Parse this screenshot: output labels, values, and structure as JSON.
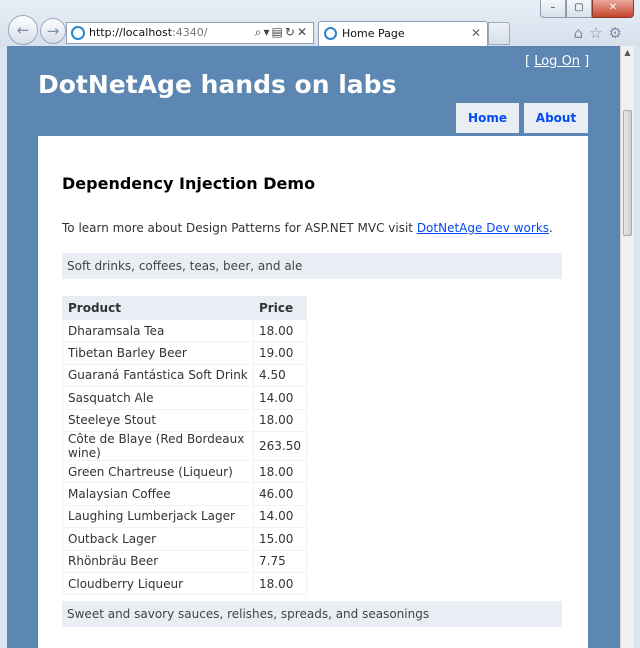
{
  "browser": {
    "url_host": "http://localhost",
    "url_port": ":4340/",
    "tab_title": "Home Page"
  },
  "site": {
    "title": "DotNetAge hands on labs",
    "logon_open": "[ ",
    "logon_label": "Log On",
    "logon_close": " ]",
    "menu": [
      "Home",
      "About"
    ]
  },
  "content": {
    "heading": "Dependency Injection Demo",
    "intro_text": "To learn more about Design Patterns for ASP.NET MVC visit ",
    "intro_link": "DotNetAge Dev works",
    "intro_end": ".",
    "categories": [
      "Soft drinks, coffees, teas, beer, and ale",
      "Sweet and savory sauces, relishes, spreads, and seasonings"
    ],
    "table": {
      "headers": [
        "Product",
        "Price"
      ],
      "rows": [
        [
          "Dharamsala Tea",
          "18.00"
        ],
        [
          "Tibetan Barley Beer",
          "19.00"
        ],
        [
          "Guaraná Fantástica Soft Drink",
          "4.50"
        ],
        [
          "Sasquatch Ale",
          "14.00"
        ],
        [
          "Steeleye Stout",
          "18.00"
        ],
        [
          "Côte de Blaye (Red Bordeaux wine)",
          "263.50"
        ],
        [
          "Green Chartreuse (Liqueur)",
          "18.00"
        ],
        [
          "Malaysian Coffee",
          "46.00"
        ],
        [
          "Laughing Lumberjack Lager",
          "14.00"
        ],
        [
          "Outback Lager",
          "15.00"
        ],
        [
          "Rhönbräu Beer",
          "7.75"
        ],
        [
          "Cloudberry Liqueur",
          "18.00"
        ]
      ]
    }
  },
  "colors": {
    "page_bg": "#5c87b2",
    "panel_bg": "#e8eef4",
    "link": "#034af3"
  },
  "icons": [
    "back-icon",
    "forward-icon",
    "ie-logo-icon",
    "search-icon",
    "refresh-icon",
    "stop-icon",
    "home-icon",
    "favorites-icon",
    "tools-gear-icon"
  ]
}
